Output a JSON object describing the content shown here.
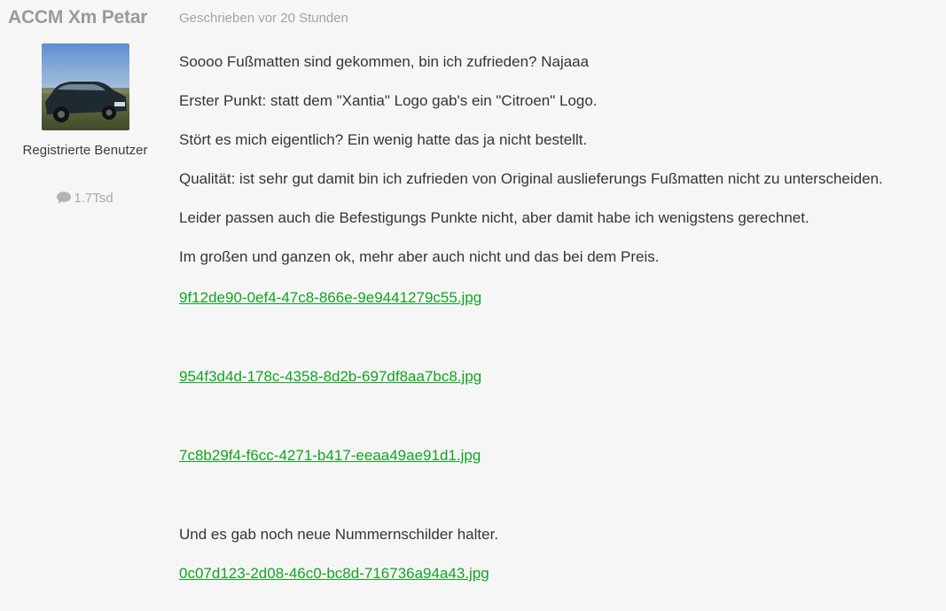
{
  "author": {
    "name": "ACCM Xm Petar",
    "group": "Registrierte Benutzer",
    "post_count": "1.7Tsd",
    "avatar_icon": "car-photo"
  },
  "post": {
    "time": "Geschrieben vor 20 Stunden",
    "paragraphs": [
      "Soooo Fußmatten sind gekommen, bin ich zufrieden? Najaaa",
      "Erster Punkt: statt dem \"Xantia\" Logo gab's ein \"Citroen\" Logo.",
      "Stört es mich eigentlich? Ein wenig hatte das ja nicht bestellt.",
      "Qualität: ist sehr gut damit bin ich zufrieden von Original auslieferungs Fußmatten nicht zu unterscheiden.",
      "Leider passen auch die Befestigungs Punkte nicht, aber damit habe ich wenigstens gerechnet.",
      "Im großen und ganzen ok, mehr aber auch nicht und das bei dem Preis."
    ],
    "attachments": [
      "9f12de90-0ef4-47c8-866e-9e9441279c55.jpg",
      "954f3d4d-178c-4358-8d2b-697df8aa7bc8.jpg",
      "7c8b29f4-f6cc-4271-b417-eeaa49ae91d1.jpg"
    ],
    "closing_text": "Und es gab noch neue Nummernschilder halter.",
    "final_attachment": "0c07d123-2d08-46c0-bc8d-716736a94a43.jpg"
  },
  "colors": {
    "link": "#12a321",
    "muted": "#9a9a9a",
    "text": "#353535",
    "background": "#f7f6f7"
  }
}
